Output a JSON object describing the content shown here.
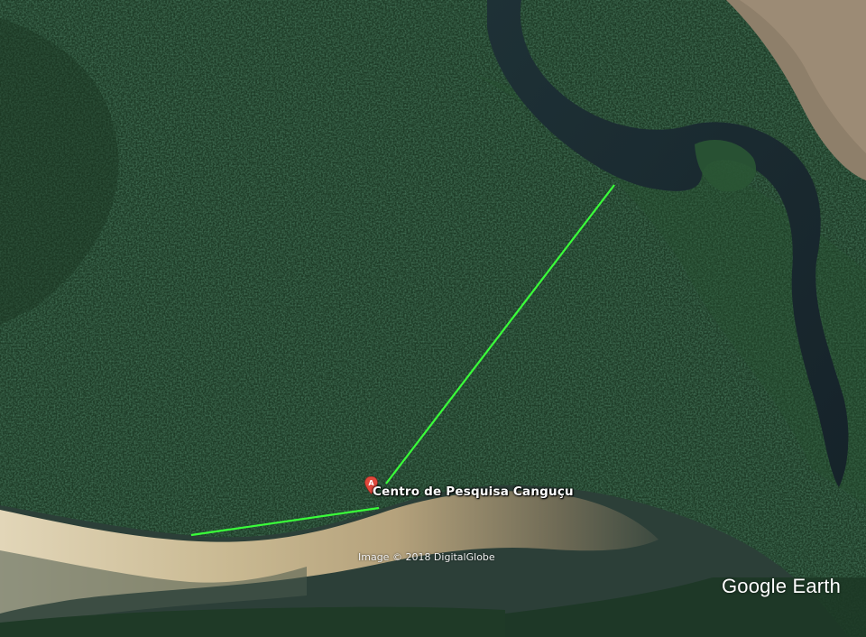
{
  "place": {
    "marker_letter": "A",
    "name": "Centro de Pesquisa Canguçu",
    "marker_color": "#e0483c"
  },
  "attribution": {
    "imagery": "Image © 2018 DigitalGlobe",
    "brand": "Google Earth"
  },
  "colors": {
    "forest": "#1f3d28",
    "river": "#1a2a2f",
    "sandbar": "#d6c6a4",
    "measure_line": "#3aff3a"
  }
}
